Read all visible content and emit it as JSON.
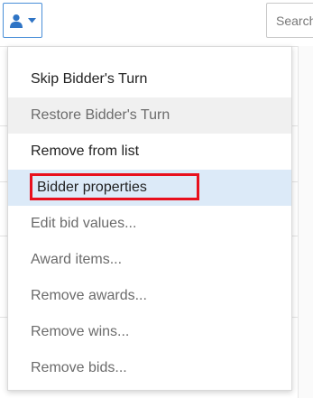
{
  "toolbar": {
    "user_button_icon": "user-icon",
    "user_button_caret": "caret-down-icon",
    "search_placeholder": "Search"
  },
  "menu": {
    "items": [
      {
        "label": "Skip Bidder's Turn",
        "state": "enabled"
      },
      {
        "label": "Restore Bidder's Turn",
        "state": "disabled"
      },
      {
        "label": "Remove from list",
        "state": "enabled"
      },
      {
        "label": "Bidder properties",
        "state": "highlighted"
      },
      {
        "label": "Edit bid values...",
        "state": "disabled"
      },
      {
        "label": "Award items...",
        "state": "disabled"
      },
      {
        "label": "Remove awards...",
        "state": "disabled"
      },
      {
        "label": "Remove wins...",
        "state": "disabled"
      },
      {
        "label": "Remove bids...",
        "state": "disabled"
      }
    ]
  },
  "colors": {
    "accent": "#4a8fd8",
    "highlight_outline": "#e8101d",
    "selected_background": "#dceaf8"
  }
}
